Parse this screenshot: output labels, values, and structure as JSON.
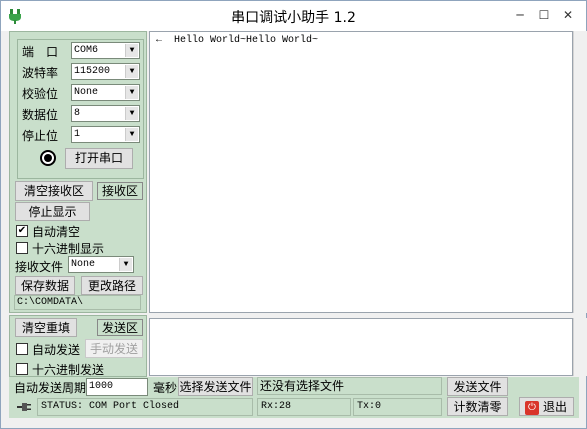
{
  "window": {
    "title": "串口调试小助手 1.2",
    "min_glyph": "─",
    "max_glyph": "☐",
    "close_glyph": "✕"
  },
  "settings": {
    "port_label": "端　口",
    "port_value": "COM6",
    "baud_label": "波特率",
    "baud_value": "115200",
    "parity_label": "校验位",
    "parity_value": "None",
    "databits_label": "数据位",
    "databits_value": "8",
    "stopbits_label": "停止位",
    "stopbits_value": "1",
    "open_port_button": "打开串口"
  },
  "receive": {
    "clear_button": "清空接收区",
    "area_tag": "接收区",
    "stop_display_button": "停止显示",
    "auto_clear_label": "自动清空",
    "auto_clear_checked": true,
    "hex_display_label": "十六进制显示",
    "hex_display_checked": false,
    "receive_file_label": "接收文件",
    "receive_file_value": "None",
    "save_data_button": "保存数据",
    "change_path_button": "更改路径",
    "path": "C:\\COMDATA\\",
    "content": "←  Hello World~Hello World~"
  },
  "send": {
    "clear_button": "清空重填",
    "area_tag": "发送区",
    "auto_send_label": "自动发送",
    "auto_send_checked": false,
    "manual_send_button": "手动发送",
    "hex_send_label": "十六进制发送",
    "hex_send_checked": false,
    "period_label": "自动发送周期",
    "period_value": "1000",
    "period_unit": "毫秒",
    "select_file_button": "选择发送文件",
    "no_file_text": "还没有选择文件",
    "send_file_button": "发送文件",
    "reset_counter_button": "计数清零",
    "exit_button": "退出",
    "content": ""
  },
  "status": {
    "text": "STATUS: COM Port Closed",
    "rx": "Rx:28",
    "tx": "Tx:0"
  },
  "colors": {
    "panel": "#c9dfcb",
    "exit_icon": "#d9352a"
  }
}
